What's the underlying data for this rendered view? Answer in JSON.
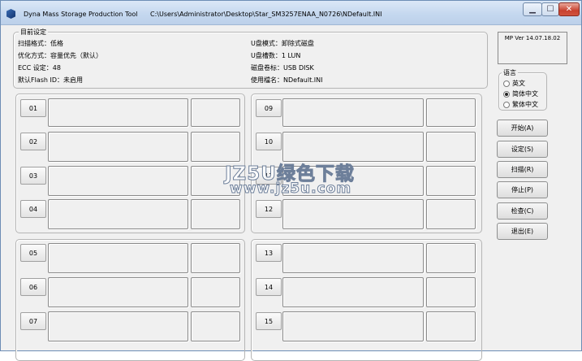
{
  "window": {
    "app_title": "Dyna Mass Storage Production Tool",
    "file_path": "C:\\Users\\Administrator\\Desktop\\Star_SM3257ENAA_N0726\\NDefault.INI",
    "controls": {
      "minimize": "▁",
      "maximize": "☐",
      "close": "✕"
    }
  },
  "settings": {
    "title": "目前设定",
    "scan_format": "扫描格式：低格",
    "optimize_mode": "优化方式：容量优先（默认）",
    "ecc": "ECC 设定：48",
    "flash_id": "默认Flash ID：未启用",
    "udisk_mode": "U盘模式：卸除式磁盘",
    "udisk_count": "U盘槽数：1 LUN",
    "volume_label": "磁盘卷标：USB DISK",
    "file_name": "使用檔名：NDefault.INI"
  },
  "ports": {
    "group1": [
      "01",
      "02",
      "03",
      "04"
    ],
    "group2": [
      "09",
      "10",
      "11",
      "12"
    ],
    "group3": [
      "05",
      "06",
      "07"
    ],
    "group4": [
      "13",
      "14",
      "15"
    ]
  },
  "version": "MP Ver 14.07.18.02",
  "language": {
    "title": "语言",
    "options": [
      "英文",
      "简体中文",
      "繁体中文"
    ],
    "selected_index": 1
  },
  "actions": {
    "start": "开始(A)",
    "settings": "设定(S)",
    "scan": "扫描(R)",
    "stop": "停止(P)",
    "check": "检查(C)",
    "exit": "退出(E)"
  },
  "watermark": {
    "line1": "JZ5U绿色下载",
    "line2": "www.jz5u.com"
  },
  "colors": {
    "titlebar": "#c5d8ef",
    "close_button": "#c8412f",
    "window_bg": "#f0f0f0"
  }
}
